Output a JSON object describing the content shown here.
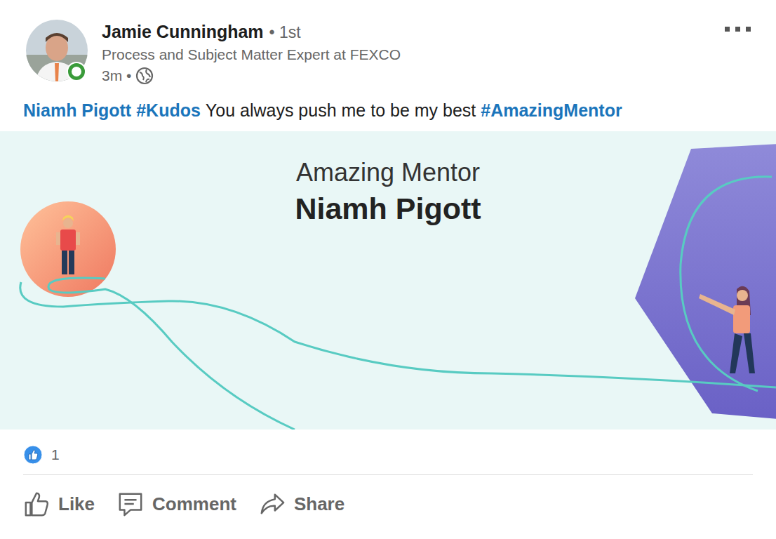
{
  "author": {
    "name": "Jamie Cunningham",
    "degree": "• 1st",
    "headline": "Process and Subject Matter Expert at FEXCO",
    "time": "3m •",
    "online": true
  },
  "post": {
    "segments": [
      {
        "text": "Niamh Pigott",
        "kind": "mention"
      },
      {
        "text": "#Kudos",
        "kind": "hashtag"
      },
      {
        "text": "You always push me to be my best",
        "kind": "text"
      },
      {
        "text": "#AmazingMentor",
        "kind": "hashtag"
      }
    ]
  },
  "banner": {
    "title": "Amazing Mentor",
    "name": "Niamh Pigott"
  },
  "reactions": {
    "count": "1"
  },
  "actions": [
    {
      "label": "Like"
    },
    {
      "label": "Comment"
    },
    {
      "label": "Share"
    }
  ]
}
